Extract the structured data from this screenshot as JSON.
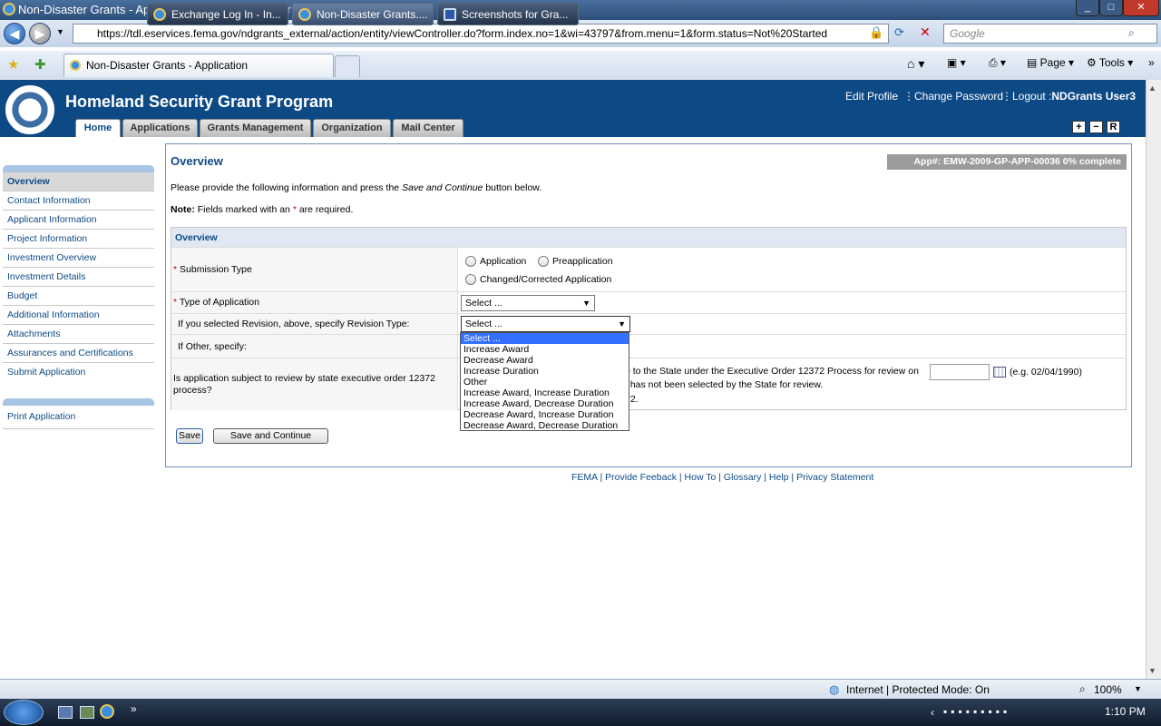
{
  "window": {
    "title": "Non-Disaster Grants - Application - Internet Explorer provided by Dell"
  },
  "browser": {
    "url": "https://tdl.eservices.fema.gov/ndgrants_external/action/entity/viewController.do?form.index.no=1&wi=43797&from.menu=1&form.status=Not%20Started",
    "search_placeholder": "Google",
    "tab_title": "Non-Disaster Grants - Application",
    "tools": {
      "page": "Page",
      "tools": "Tools"
    }
  },
  "app": {
    "title": "Homeland Security Grant Program",
    "toplinks": {
      "edit_profile": "Edit Profile",
      "change_password": "Change Password",
      "logout": "Logout :",
      "user": "NDGrants User3"
    },
    "zoom_buttons": {
      "plus": "+",
      "minus": "−",
      "reset": "R"
    },
    "tabs": [
      "Home",
      "Applications",
      "Grants Management",
      "Organization",
      "Mail Center"
    ]
  },
  "sidebar": {
    "items": [
      "Overview",
      "Contact Information",
      "Applicant Information",
      "Project Information",
      "Investment Overview",
      "Investment Details",
      "Budget",
      "Additional Information",
      "Attachments",
      "Assurances and Certifications",
      "Submit Application"
    ],
    "items2": [
      "Print Application"
    ]
  },
  "main": {
    "title": "Overview",
    "app_number": "App#: EMW-2009-GP-APP-00036 0% complete",
    "intro_pre": "Please provide the following information and press the ",
    "intro_em": "Save and Continue",
    "intro_post": " button below.",
    "note_label": "Note:",
    "note_pre": " Fields marked with an ",
    "note_star": "*",
    "note_post": " are required.",
    "section": "Overview",
    "fields": {
      "submission_type": "Submission Type",
      "radio_application": "Application",
      "radio_preapplication": "Preapplication",
      "radio_changed": "Changed/Corrected Application",
      "type_of_application": "Type of Application",
      "type_value": "Select ...",
      "revision_label": "If you selected Revision, above, specify Revision Type:",
      "revision_value": "Select ...",
      "other_label": "If Other, specify:",
      "review_label": "Is application subject to review by state executive order 12372 process?",
      "review_line1": "e to the State under the Executive Order 12372 Process for review on",
      "review_line2": "t has not been selected by the State for review.",
      "review_line3": "72.",
      "date_hint": "(e.g. 02/04/1990)"
    },
    "dropdown_options": [
      "Select ...",
      "Increase Award",
      "Decrease Award",
      "Increase Duration",
      "Other",
      "Increase Award, Increase Duration",
      "Increase Award, Decrease Duration",
      "Decrease Award, Increase Duration",
      "Decrease Award, Decrease Duration"
    ],
    "buttons": {
      "save": "Save",
      "save_continue": "Save and Continue"
    }
  },
  "footer": [
    "FEMA",
    "Provide Feeback",
    "How To",
    "Glossary",
    "Help",
    "Privacy Statement"
  ],
  "statusbar": {
    "zone": "Internet | Protected Mode: On",
    "zoom": "100%"
  },
  "taskbar": {
    "tasks": [
      "Exchange Log In - In...",
      "Non-Disaster Grants....",
      "Screenshots for Gra..."
    ],
    "clock": "1:10 PM"
  },
  "colors": {
    "brand": "#0d4a85",
    "accent": "#a9c5e6",
    "highlight": "#3370ff"
  }
}
